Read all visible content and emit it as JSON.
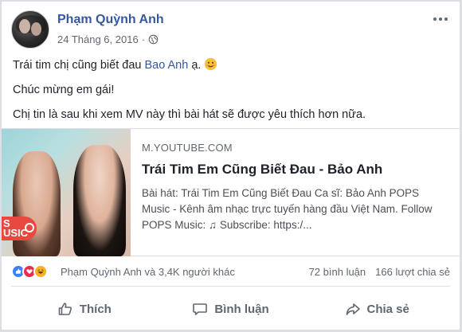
{
  "post": {
    "author": "Phạm Quỳnh Anh",
    "date": "24 Tháng 6, 2016",
    "privacy_icon": "globe-icon",
    "lines": {
      "l1_before": "Trái tim chị cũng biết đau ",
      "l1_mention": "Bao Anh",
      "l1_after": " ạ. ",
      "l2": "Chúc mừng em gái!",
      "l3": "Chị tin là sau khi xem MV này thì bài hát sẽ được yêu thích hơn nữa."
    }
  },
  "link_preview": {
    "domain": "M.YOUTUBE.COM",
    "title": "Trái Tim Em Cũng Biết Đau - Bảo Anh",
    "description": "Bài hát: Trái Tim Em Cũng Biết Đau Ca sĩ: Bảo Anh POPS Music - Kênh âm nhạc trực tuyến hàng đầu Việt Nam. Follow POPS Music: ♫ Subscribe: https:/...",
    "badge_text": "S\nUSIC"
  },
  "reactions": {
    "names": "Phạm Quỳnh Anh và 3,4K người khác",
    "comments": "72 bình luận",
    "shares": "166 lượt chia sẻ"
  },
  "actions": {
    "like": "Thích",
    "comment": "Bình luận",
    "share": "Chia sẻ"
  },
  "colors": {
    "link": "#365899",
    "text": "#1d2129",
    "muted": "#606770"
  }
}
